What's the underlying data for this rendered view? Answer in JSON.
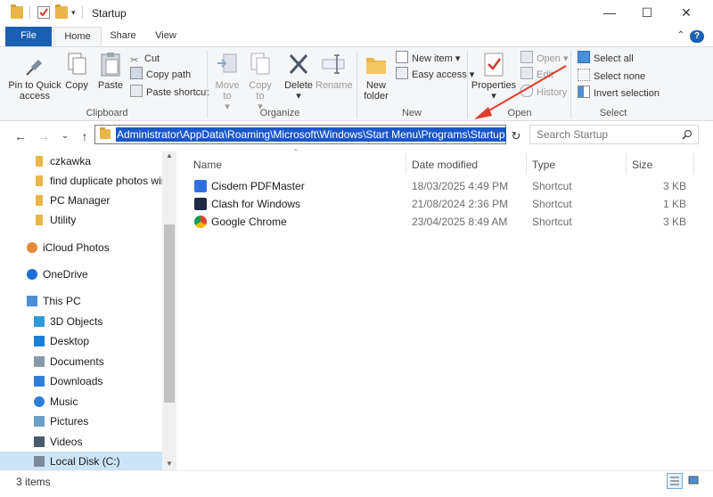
{
  "window": {
    "title": "Startup",
    "minimize": "—",
    "maximize": "☐",
    "close": "✕"
  },
  "tabs": [
    "File",
    "Home",
    "Share",
    "View"
  ],
  "ribbon": {
    "clipboard": {
      "label": "Clipboard",
      "pin": "Pin to Quick access",
      "copy": "Copy",
      "paste": "Paste",
      "cut": "Cut",
      "copy_path": "Copy path",
      "paste_shortcut": "Paste shortcut"
    },
    "organize": {
      "label": "Organize",
      "move_to": "Move to",
      "copy_to": "Copy to",
      "delete": "Delete",
      "rename": "Rename"
    },
    "new": {
      "label": "New",
      "new_folder": "New folder",
      "new_item": "New item",
      "easy_access": "Easy access"
    },
    "open": {
      "label": "Open",
      "properties": "Properties",
      "open": "Open",
      "edit": "Edit",
      "history": "History"
    },
    "select": {
      "label": "Select",
      "select_all": "Select all",
      "select_none": "Select none",
      "invert": "Invert selection"
    }
  },
  "address": {
    "path": "Administrator\\AppData\\Roaming\\Microsoft\\Windows\\Start Menu\\Programs\\Startup",
    "search_placeholder": "Search Startup"
  },
  "sidebar": {
    "items": [
      {
        "label": "czkawka",
        "icon": "folder-icon"
      },
      {
        "label": "find duplicate photos win",
        "icon": "folder-icon"
      },
      {
        "label": "PC Manager",
        "icon": "folder-icon"
      },
      {
        "label": "Utility",
        "icon": "folder-icon"
      },
      {
        "label": "iCloud Photos",
        "icon": "icloud-photos-icon"
      },
      {
        "label": "OneDrive",
        "icon": "onedrive-icon"
      },
      {
        "label": "This PC",
        "icon": "computer-icon"
      },
      {
        "label": "3D Objects",
        "icon": "3d-objects-icon"
      },
      {
        "label": "Desktop",
        "icon": "desktop-icon"
      },
      {
        "label": "Documents",
        "icon": "documents-icon"
      },
      {
        "label": "Downloads",
        "icon": "downloads-icon"
      },
      {
        "label": "Music",
        "icon": "music-icon"
      },
      {
        "label": "Pictures",
        "icon": "pictures-icon"
      },
      {
        "label": "Videos",
        "icon": "videos-icon"
      },
      {
        "label": "Local Disk (C:)",
        "icon": "local-disk-icon"
      }
    ]
  },
  "columns": {
    "name": "Name",
    "date": "Date modified",
    "type": "Type",
    "size": "Size"
  },
  "files": [
    {
      "name": "Cisdem PDFMaster",
      "date": "18/03/2025 4:49 PM",
      "type": "Shortcut",
      "size": "3 KB",
      "color": "#2f6fe0"
    },
    {
      "name": "Clash for Windows",
      "date": "21/08/2024 2:36 PM",
      "type": "Shortcut",
      "size": "1 KB",
      "color": "#1f2a44"
    },
    {
      "name": "Google Chrome",
      "date": "23/04/2025 8:49 AM",
      "type": "Shortcut",
      "size": "3 KB",
      "color": "#db4437"
    }
  ],
  "status": {
    "count": "3 items"
  }
}
